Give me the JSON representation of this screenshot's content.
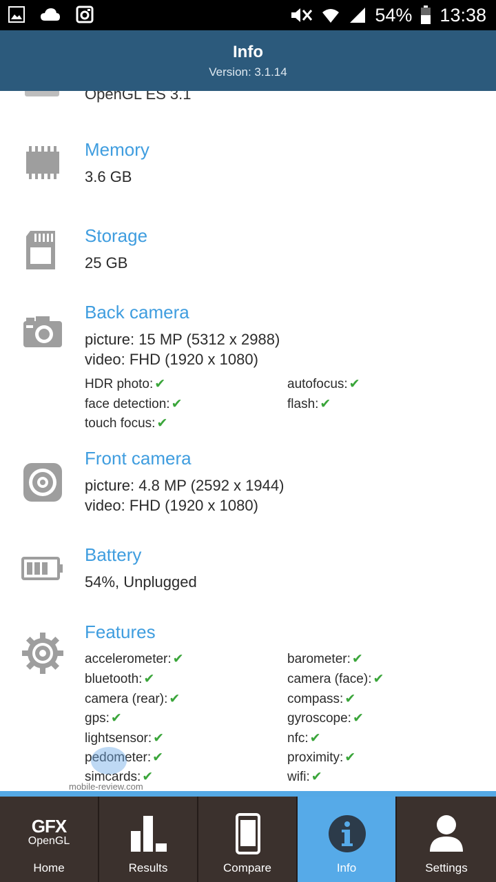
{
  "status_bar": {
    "battery_percent": "54%",
    "time": "13:38"
  },
  "app_bar": {
    "title": "Info",
    "version": "Version: 3.1.14"
  },
  "partial_line": "OpenGL ES 3.1",
  "sections": {
    "memory": {
      "title": "Memory",
      "value": "3.6 GB",
      "icon": "memory-chip-icon"
    },
    "storage": {
      "title": "Storage",
      "value": "25 GB",
      "icon": "sd-card-icon"
    },
    "back_camera": {
      "title": "Back camera",
      "picture": "picture: 15 MP (5312 x 2988)",
      "video": "video: FHD (1920 x 1080)",
      "features": [
        "HDR photo:",
        "autofocus:",
        "face detection:",
        "flash:",
        "touch focus:"
      ],
      "icon": "camera-icon"
    },
    "front_camera": {
      "title": "Front camera",
      "picture": "picture: 4.8 MP (2592 x 1944)",
      "video": "video: FHD (1920 x 1080)",
      "icon": "front-camera-icon"
    },
    "battery": {
      "title": "Battery",
      "value": "54%, Unplugged",
      "icon": "battery-icon"
    },
    "features": {
      "title": "Features",
      "items": [
        "accelerometer:",
        "barometer:",
        "bluetooth:",
        "camera (face):",
        "camera (rear):",
        "compass:",
        "gps:",
        "gyroscope:",
        "lightsensor:",
        "nfc:",
        "pedometer:",
        "proximity:",
        "simcards:",
        "wifi:"
      ],
      "icon": "gear-icon"
    }
  },
  "check_mark": "✔",
  "watermark": "mobile-review.com",
  "bottom_nav": {
    "home": {
      "line1": "GFX",
      "line2": "OpenGL",
      "label": "Home"
    },
    "results": {
      "label": "Results"
    },
    "compare": {
      "label": "Compare"
    },
    "info": {
      "label": "Info"
    },
    "settings": {
      "label": "Settings"
    },
    "active": "Info"
  },
  "colors": {
    "app_bar": "#2c5a7c",
    "accent": "#3f9ddf",
    "check": "#3aa53a",
    "nav_bg": "#3b312d",
    "nav_active": "#56aae8"
  }
}
